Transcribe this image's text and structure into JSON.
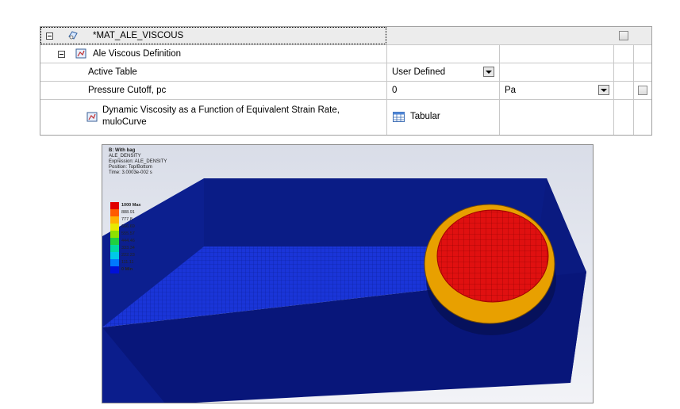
{
  "grid": {
    "rows": [
      {
        "label": "*MAT_ALE_VISCOUS"
      },
      {
        "label": "Ale Viscous Definition"
      },
      {
        "label": "Active Table",
        "value": "User Defined"
      },
      {
        "label": "Pressure Cutoff, pc",
        "value": "0",
        "unit": "Pa"
      },
      {
        "label_line1": "Dynamic Viscosity as a Function of Equivalent Strain Rate,",
        "label_line2": "muloCurve",
        "value": "Tabular"
      }
    ]
  },
  "viewer": {
    "header": {
      "title": "B: With bag",
      "line1": "ALE_DENSITY",
      "line2": "Expression: ALE_DENSITY",
      "line3": "Position: Top/Bottom",
      "line4": "Time: 3.0003e-002 s"
    },
    "legend": [
      {
        "label": "1000 Max",
        "color": "#e00000"
      },
      {
        "label": "888.91",
        "color": "#ff5a00"
      },
      {
        "label": "777.8",
        "color": "#ffb000"
      },
      {
        "label": "666.69",
        "color": "#e8e800"
      },
      {
        "label": "555.57",
        "color": "#8ee000"
      },
      {
        "label": "444.46",
        "color": "#20d040"
      },
      {
        "label": "333.34",
        "color": "#00d8a0"
      },
      {
        "label": "222.23",
        "color": "#00c8e8"
      },
      {
        "label": "111.11",
        "color": "#0078ff"
      },
      {
        "label": "0 Min",
        "color": "#0010d8"
      }
    ]
  }
}
